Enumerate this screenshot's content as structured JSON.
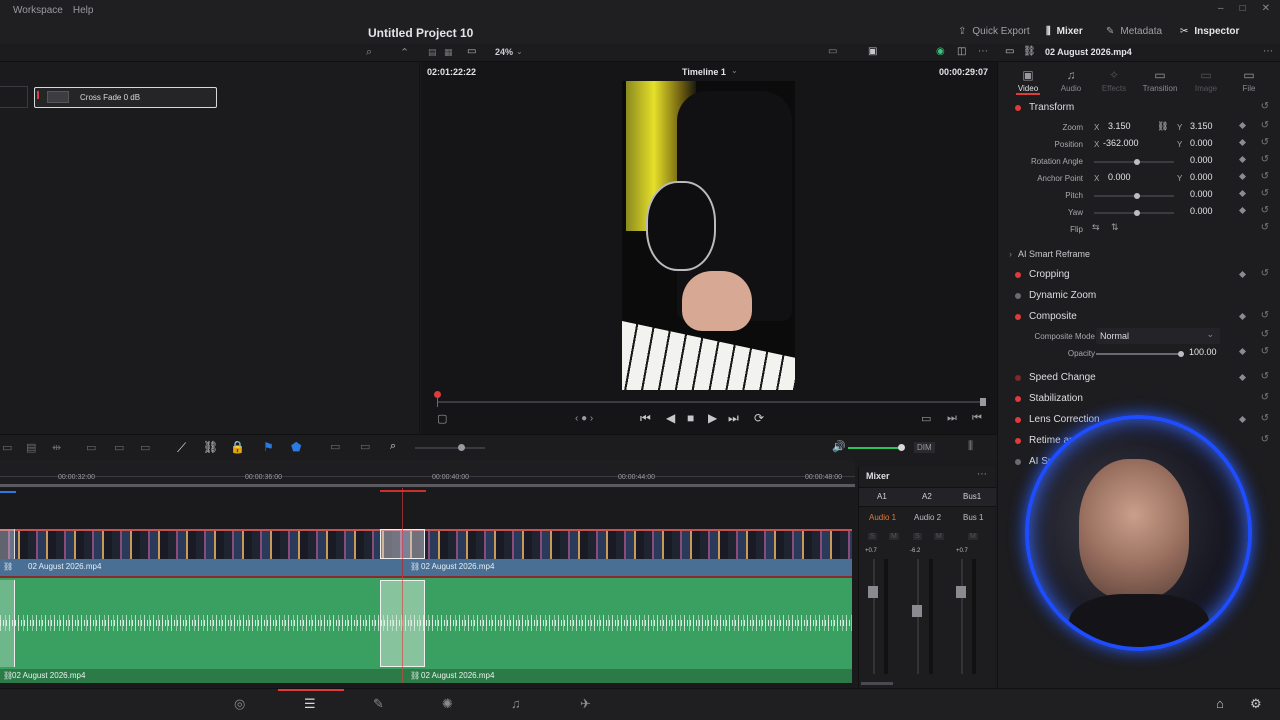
{
  "menu": {
    "items": [
      "Workspace",
      "Help"
    ]
  },
  "window": {
    "minimize": "–",
    "maximize": "□",
    "close": "✕"
  },
  "project": {
    "title": "Untitled Project 10"
  },
  "topbar": {
    "quick_export": "Quick Export",
    "mixer": "Mixer",
    "metadata": "Metadata",
    "inspector": "Inspector"
  },
  "media": {
    "clip_label": "Cross Fade 0 dB"
  },
  "viewer": {
    "zoom": "24%",
    "timecode_left": "02:01:22:22",
    "timeline_name": "Timeline 1",
    "timecode_right": "00:00:29:07"
  },
  "inspector": {
    "clip_name": "02 August 2026.mp4",
    "tabs": [
      {
        "label": "Video"
      },
      {
        "label": "Audio"
      },
      {
        "label": "Effects"
      },
      {
        "label": "Transition"
      },
      {
        "label": "Image"
      },
      {
        "label": "File"
      }
    ],
    "transform": {
      "title": "Transform",
      "zoom": {
        "label": "Zoom",
        "x_axis": "X",
        "x": "3.150",
        "y_axis": "Y",
        "y": "3.150"
      },
      "position": {
        "label": "Position",
        "x_axis": "X",
        "x": "-362.000",
        "y_axis": "Y",
        "y": "0.000"
      },
      "rotation": {
        "label": "Rotation Angle",
        "value": "0.000"
      },
      "anchor": {
        "label": "Anchor Point",
        "x_axis": "X",
        "x": "0.000",
        "y_axis": "Y",
        "y": "0.000"
      },
      "pitch": {
        "label": "Pitch",
        "value": "0.000"
      },
      "yaw": {
        "label": "Yaw",
        "value": "0.000"
      },
      "flip": {
        "label": "Flip"
      }
    },
    "smart_reframe": "AI Smart Reframe",
    "cropping": "Cropping",
    "dynamic_zoom": "Dynamic Zoom",
    "composite": {
      "title": "Composite",
      "mode_label": "Composite Mode",
      "mode": "Normal",
      "opacity_label": "Opacity",
      "opacity": "100.00"
    },
    "speed_change": "Speed Change",
    "stabilization": "Stabilization",
    "lens_correction": "Lens Correction",
    "retime": "Retime an",
    "ai_su": "AI Su"
  },
  "toolbar": {
    "dim": "DIM"
  },
  "timeline": {
    "ruler": [
      "00:00:32:00",
      "00:00:36:00",
      "00:00:40:00",
      "00:00:44:00",
      "00:00:48:00"
    ],
    "video_clip_a": "02 August 2026.mp4",
    "video_clip_b": "02 August 2026.mp4",
    "audio_clip_a": "02 August 2026.mp4",
    "audio_clip_b": "02 August 2026.mp4"
  },
  "mixer": {
    "title": "Mixer",
    "channels": [
      "A1",
      "A2",
      "Bus1"
    ],
    "names": [
      "Audio 1",
      "Audio 2",
      "Bus 1"
    ],
    "levels": [
      "+0.7",
      "-6.2",
      "+0.7"
    ]
  },
  "colors": {
    "accent": "#e03a3a",
    "video_track": "#4a6f95",
    "audio_track": "#3aa062",
    "webcam_ring": "#1e4dff"
  }
}
